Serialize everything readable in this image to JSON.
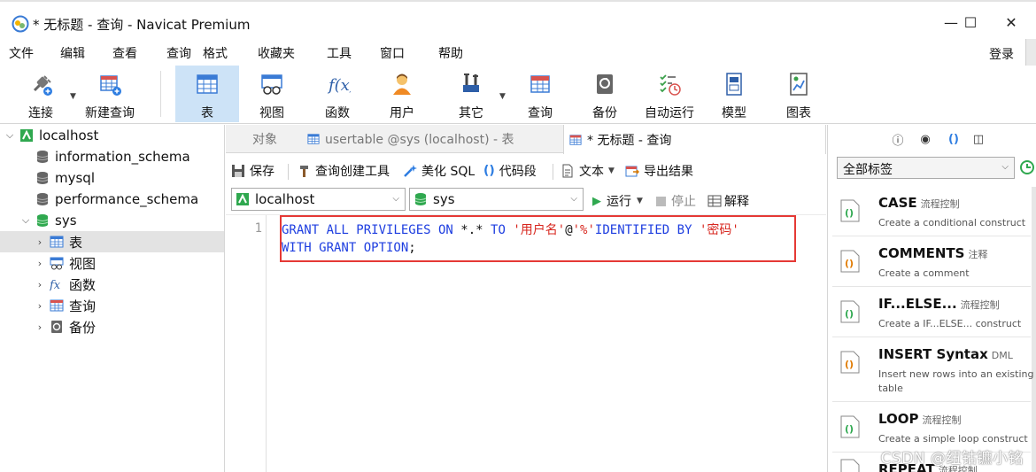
{
  "window": {
    "title": "* 无标题 - 查询 - Navicat Premium",
    "minimize": "—",
    "maximize": "☐",
    "close": "✕"
  },
  "menu": {
    "items": [
      "文件",
      "编辑",
      "查看",
      "查询",
      "格式",
      "收藏夹",
      "工具",
      "窗口",
      "帮助"
    ],
    "login": "登录"
  },
  "toolbar": {
    "items": [
      "连接",
      "新建查询",
      "表",
      "视图",
      "函数",
      "用户",
      "其它",
      "查询",
      "备份",
      "自动运行",
      "模型",
      "图表"
    ],
    "active": "表"
  },
  "tree": {
    "items": [
      {
        "label": "localhost",
        "level": 0,
        "expanded": true,
        "icon": "connection-icon"
      },
      {
        "label": "information_schema",
        "level": 1,
        "icon": "database-icon"
      },
      {
        "label": "mysql",
        "level": 1,
        "icon": "database-icon"
      },
      {
        "label": "performance_schema",
        "level": 1,
        "icon": "database-icon"
      },
      {
        "label": "sys",
        "level": 1,
        "expanded": true,
        "icon": "database-active-icon"
      },
      {
        "label": "表",
        "level": 2,
        "icon": "table-icon",
        "selected": true
      },
      {
        "label": "视图",
        "level": 2,
        "icon": "view-icon"
      },
      {
        "label": "函数",
        "level": 2,
        "icon": "function-icon"
      },
      {
        "label": "查询",
        "level": 2,
        "icon": "query-icon"
      },
      {
        "label": "备份",
        "level": 2,
        "icon": "backup-icon"
      }
    ]
  },
  "tabs": {
    "objects": "对象",
    "usertable": "usertable @sys (localhost) - 表",
    "query": "* 无标题 - 查询"
  },
  "query_toolbar": {
    "save": "保存",
    "builder": "查询创建工具",
    "beautify": "美化 SQL",
    "snippet": "代码段",
    "text": "文本",
    "export": "导出结果"
  },
  "selectors": {
    "connection": "localhost",
    "database": "sys",
    "run": "运行",
    "stop": "停止",
    "explain": "解释"
  },
  "editor": {
    "line_number": "1",
    "code": {
      "t1": "GRANT ALL PRIVILEGES ON",
      "t2": " *.* ",
      "t3": "TO",
      "t4": " ",
      "t5": "'用户名'",
      "t6": "@",
      "t7": "'%'",
      "t8": "IDENTIFIED BY",
      "t9": " ",
      "t10": "'密码'",
      "line2": "WITH GRANT OPTION",
      "line2_end": ";"
    }
  },
  "right_panel": {
    "filter": "全部标签",
    "snippets": [
      {
        "title": "CASE",
        "tag": "流程控制",
        "desc": "Create a conditional construct"
      },
      {
        "title": "COMMENTS",
        "tag": "注释",
        "desc": "Create a comment"
      },
      {
        "title": "IF...ELSE...",
        "tag": "流程控制",
        "desc": "Create a IF...ELSE... construct"
      },
      {
        "title": "INSERT Syntax",
        "tag": "DML",
        "desc": "Insert new rows into an existing table"
      },
      {
        "title": "LOOP",
        "tag": "流程控制",
        "desc": "Create a simple loop construct"
      },
      {
        "title": "REPEAT",
        "tag": "流程控制",
        "desc": ""
      }
    ]
  },
  "watermark": "CSDN @纽钴镳小铭",
  "colors": {
    "keyword": "#1e3ee0",
    "string": "#d7261e",
    "highlight_border": "#e53935",
    "active_tool": "#cde3f7"
  }
}
